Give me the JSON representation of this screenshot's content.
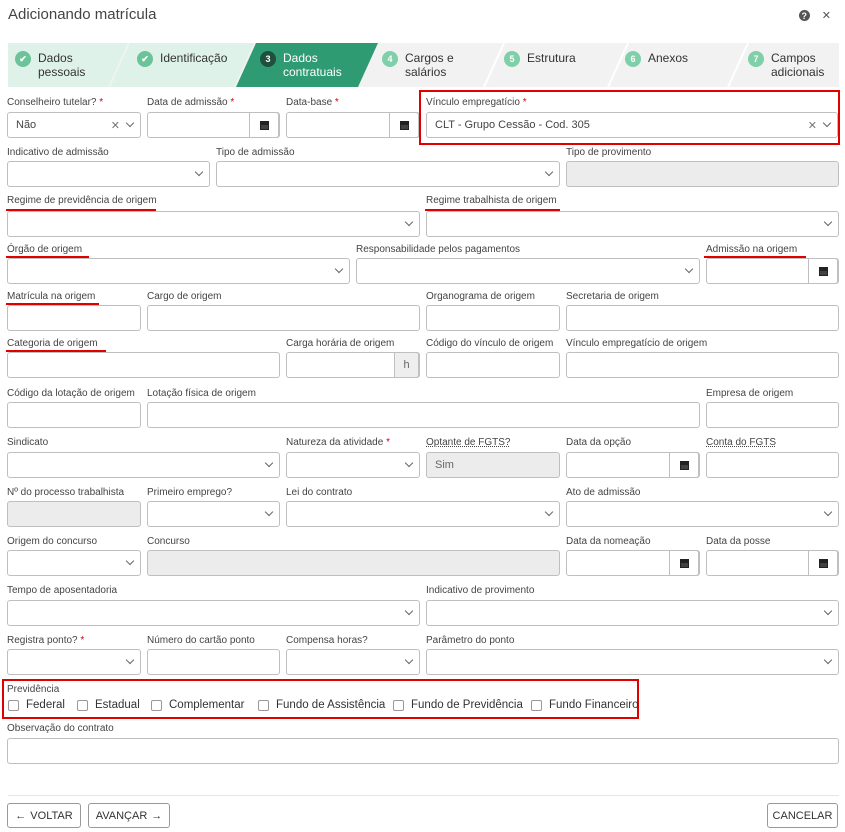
{
  "window": {
    "title": "Adicionando matrícula"
  },
  "steps": [
    {
      "num": "✔",
      "label": "Dados\npessoais",
      "state": "done"
    },
    {
      "num": "✔",
      "label": "Identificação",
      "state": "done"
    },
    {
      "num": "3",
      "label": "Dados\ncontratuais",
      "state": "active"
    },
    {
      "num": "4",
      "label": "Cargos e\nsalários",
      "state": "todo"
    },
    {
      "num": "5",
      "label": "Estrutura",
      "state": "todo"
    },
    {
      "num": "6",
      "label": "Anexos",
      "state": "todo"
    },
    {
      "num": "7",
      "label": "Campos\nadicionais",
      "state": "todo"
    }
  ],
  "labels": {
    "conselheiro": "Conselheiro tutelar?",
    "data_admissao": "Data de admissão",
    "data_base": "Data-base",
    "vinculo": "Vínculo empregatício",
    "indicativo_admissao": "Indicativo de admissão",
    "tipo_admissao": "Tipo de admissão",
    "tipo_provimento": "Tipo de provimento",
    "regime_prev": "Regime de previdência de origem",
    "regime_trab": "Regime trabalhista de origem",
    "orgao": "Órgão de origem",
    "resp_pagamentos": "Responsabilidade pelos pagamentos",
    "admissao_origem": "Admissão na origem",
    "matricula_origem": "Matrícula na origem",
    "cargo_origem": "Cargo de origem",
    "organograma": "Organograma de origem",
    "secretaria": "Secretaria de origem",
    "categoria": "Categoria de origem",
    "carga_horaria": "Carga horária de origem",
    "codigo_vinculo": "Código do vínculo de origem",
    "vinculo_origem": "Vínculo empregatício de origem",
    "codigo_lotacao": "Código da lotação de origem",
    "lotacao_fisica": "Lotação física de origem",
    "empresa": "Empresa de origem",
    "sindicato": "Sindicato",
    "natureza": "Natureza da atividade",
    "optante": "Optante de FGTS?",
    "data_opcao": "Data da opção",
    "conta_fgts": "Conta do FGTS",
    "processo": "Nº do processo trabalhista",
    "primeiro_emprego": "Primeiro emprego?",
    "lei_contrato": "Lei do contrato",
    "ato_admissao": "Ato de admissão",
    "origem_concurso": "Origem do concurso",
    "concurso": "Concurso",
    "data_nomeacao": "Data da nomeação",
    "data_posse": "Data da posse",
    "tempo_aposentadoria": "Tempo de aposentadoria",
    "indicativo_provimento": "Indicativo de provimento",
    "registra_ponto": "Registra ponto?",
    "numero_cartao": "Número do cartão ponto",
    "compensa_horas": "Compensa horas?",
    "parametro_ponto": "Parâmetro do ponto",
    "previdencia": "Previdência",
    "observacao": "Observação do contrato"
  },
  "values": {
    "conselheiro": "Não",
    "vinculo": "CLT - Grupo Cessão - Cod. 305",
    "optante": "Sim",
    "carga_unit": "h"
  },
  "previdencia_options": [
    "Federal",
    "Estadual",
    "Complementar",
    "Fundo de Assistência",
    "Fundo de Previdência",
    "Fundo Financeiro"
  ],
  "buttons": {
    "voltar": "VOLTAR",
    "avancar": "AVANÇAR",
    "cancelar": "CANCELAR"
  },
  "colors": {
    "accent": "#2e9b73",
    "highlight": "#e00000"
  }
}
